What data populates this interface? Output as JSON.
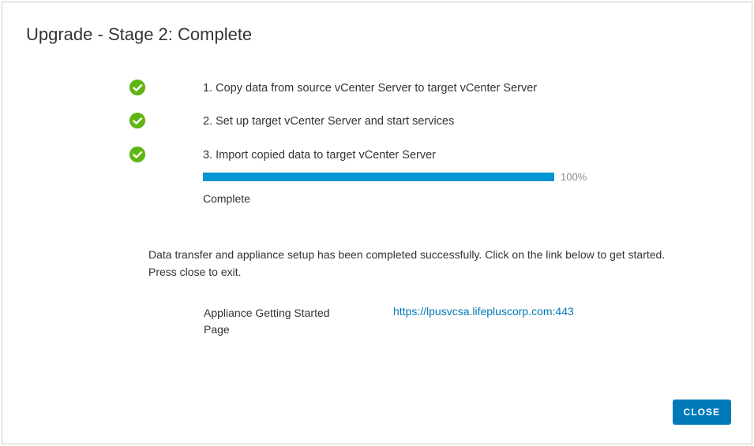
{
  "dialog": {
    "title": "Upgrade - Stage 2: Complete"
  },
  "steps": [
    {
      "label": "1. Copy data from source vCenter Server to target vCenter Server"
    },
    {
      "label": "2. Set up target vCenter Server and start services"
    },
    {
      "label": "3. Import copied data to target vCenter Server",
      "percent": "100%",
      "status": "Complete"
    }
  ],
  "message": "Data transfer and appliance setup has been completed successfully. Click on the link below to get started. Press close to exit.",
  "link": {
    "label": "Appliance Getting Started Page",
    "url": "https://lpusvcsa.lifepluscorp.com:443"
  },
  "buttons": {
    "close": "CLOSE"
  },
  "icons": {
    "check": "check-icon"
  },
  "colors": {
    "accent": "#0079b8",
    "progress": "#0095d3",
    "success": "#60b515"
  }
}
